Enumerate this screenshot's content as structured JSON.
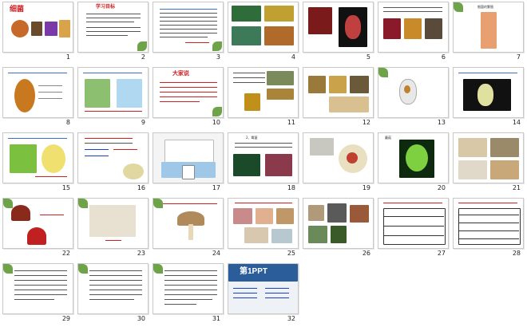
{
  "slides": [
    {
      "n": "1",
      "title": "细菌"
    },
    {
      "n": "2",
      "title": "学习目标"
    },
    {
      "n": "3",
      "title": ""
    },
    {
      "n": "4",
      "title": ""
    },
    {
      "n": "5",
      "title": ""
    },
    {
      "n": "6",
      "title": ""
    },
    {
      "n": "7",
      "title": "细菌的繁殖"
    },
    {
      "n": "8",
      "title": ""
    },
    {
      "n": "9",
      "title": ""
    },
    {
      "n": "10",
      "title": "大家说"
    },
    {
      "n": "11",
      "title": ""
    },
    {
      "n": "12",
      "title": ""
    },
    {
      "n": "13",
      "title": ""
    },
    {
      "n": "14",
      "title": ""
    },
    {
      "n": "15",
      "title": ""
    },
    {
      "n": "16",
      "title": ""
    },
    {
      "n": "17",
      "title": ""
    },
    {
      "n": "18",
      "title": "2、霉菌"
    },
    {
      "n": "19",
      "title": ""
    },
    {
      "n": "20",
      "title": "蘑菇"
    },
    {
      "n": "21",
      "title": ""
    },
    {
      "n": "22",
      "title": ""
    },
    {
      "n": "23",
      "title": ""
    },
    {
      "n": "24",
      "title": ""
    },
    {
      "n": "25",
      "title": ""
    },
    {
      "n": "26",
      "title": ""
    },
    {
      "n": "27",
      "title": ""
    },
    {
      "n": "28",
      "title": ""
    },
    {
      "n": "29",
      "title": ""
    },
    {
      "n": "30",
      "title": ""
    },
    {
      "n": "31",
      "title": ""
    },
    {
      "n": "32",
      "title": "第1PPT"
    }
  ]
}
